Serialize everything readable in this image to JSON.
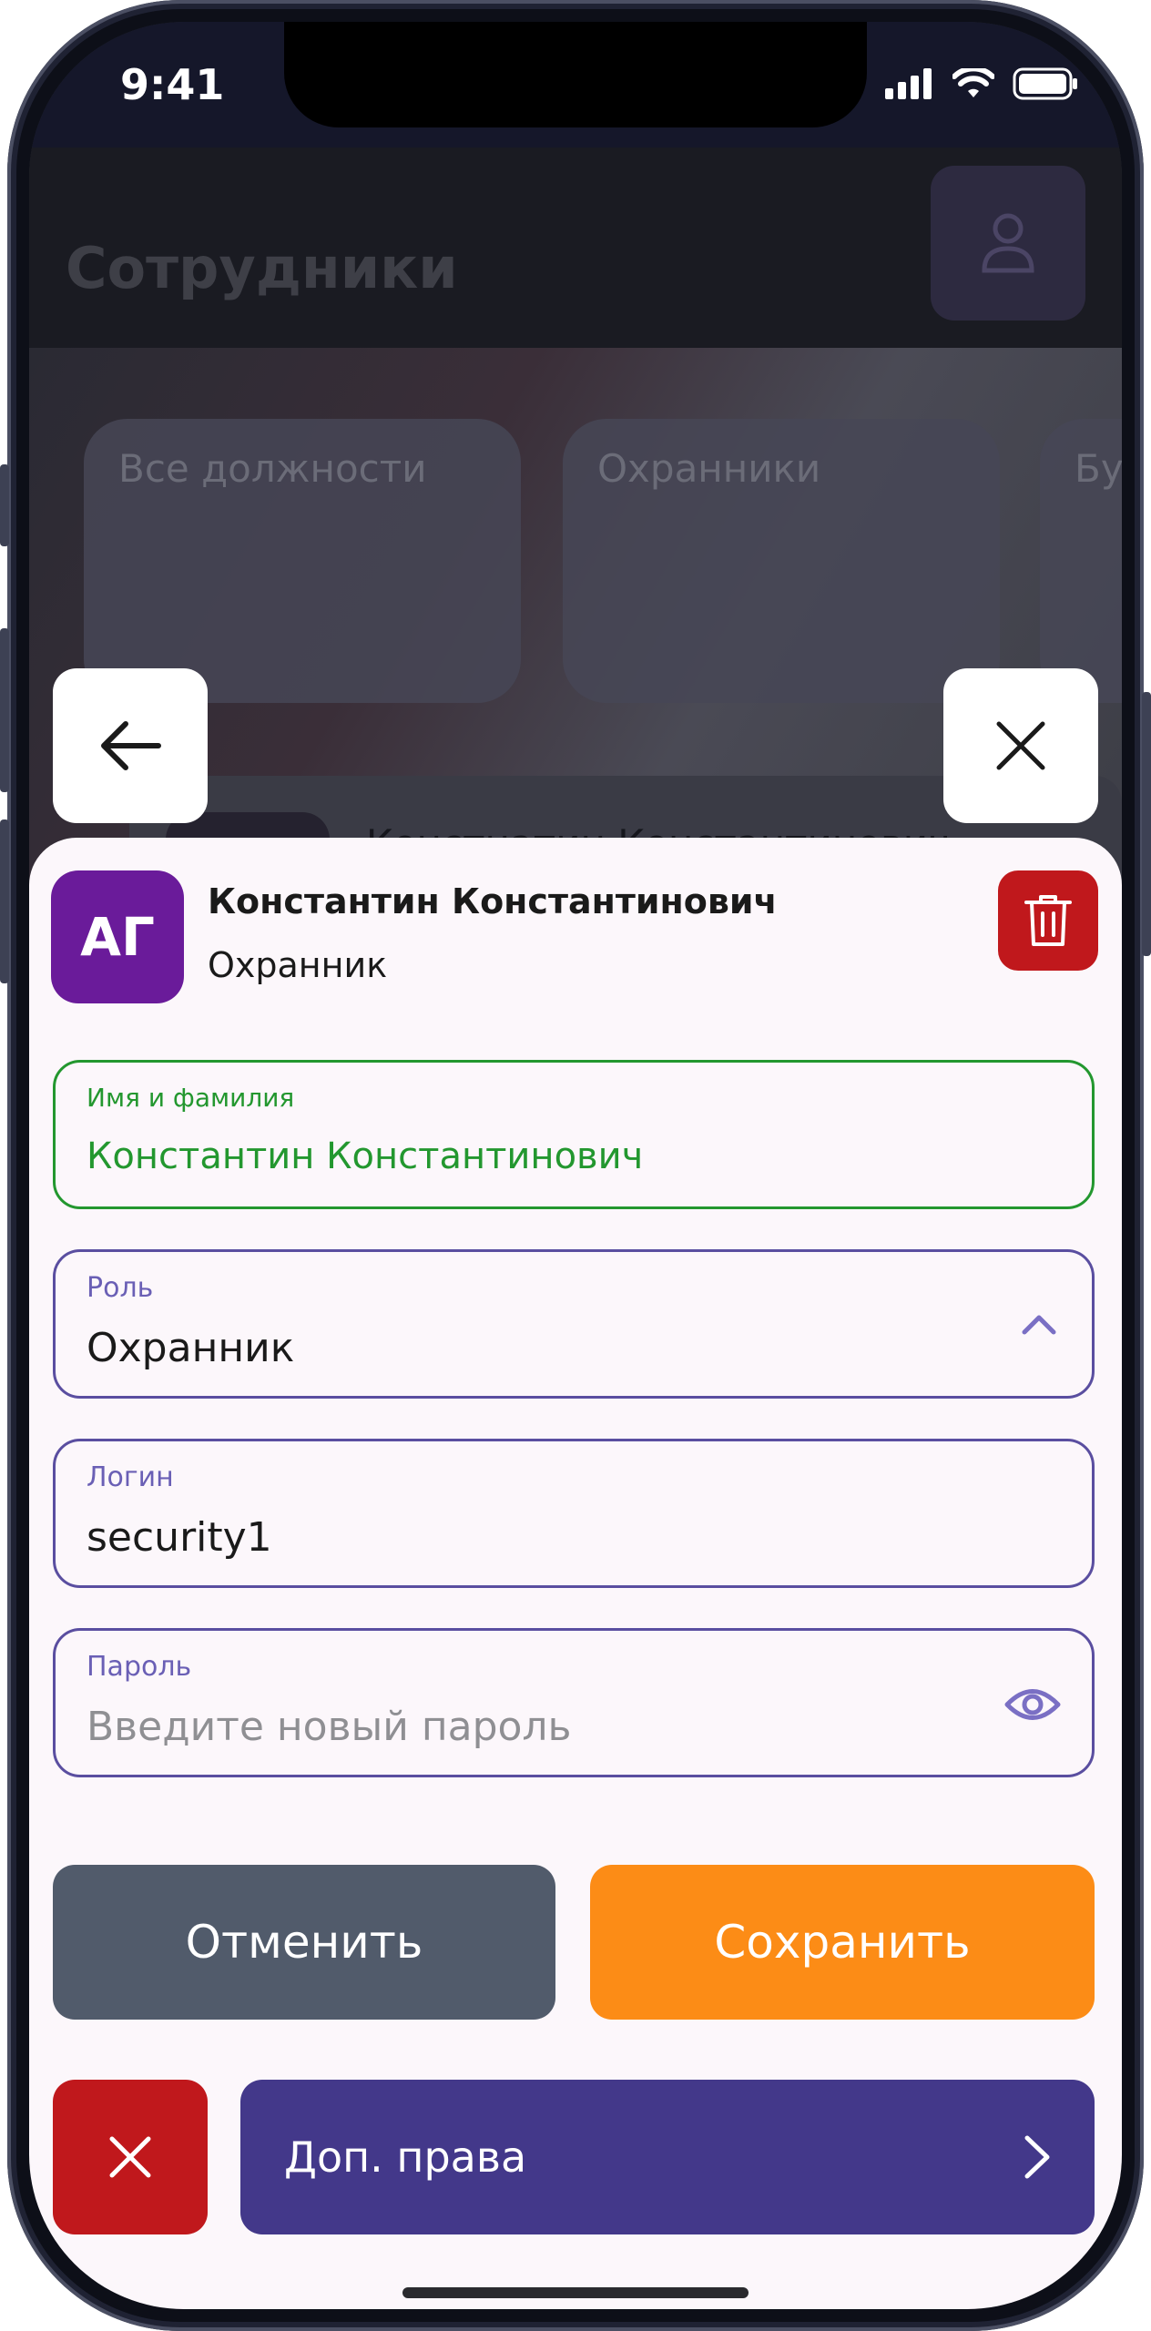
{
  "status_bar": {
    "time": "9:41"
  },
  "background": {
    "title": "Сотрудники",
    "categories": [
      "Все должности",
      "Охранники",
      "Бу"
    ],
    "employee_preview": "Констнатин Константинович"
  },
  "sheet": {
    "avatar_initials": "АГ",
    "employee_name": "Константин Константинович",
    "employee_role": "Охранник",
    "fields": {
      "name": {
        "label": "Имя и фамилия",
        "value": "Константин Константинович"
      },
      "role": {
        "label": "Роль",
        "value": "Охранник"
      },
      "login": {
        "label": "Логин",
        "value": "security1"
      },
      "password": {
        "label": "Пароль",
        "placeholder": "Введите новый пароль"
      }
    },
    "buttons": {
      "cancel": "Отменить",
      "save": "Сохранить",
      "rights": "Доп. права"
    }
  },
  "colors": {
    "accent_purple": "#43388a",
    "save_orange": "#fc8c16",
    "danger_red": "#c0181c",
    "active_green": "#23972f",
    "avatar_purple": "#6a1b9a"
  },
  "icons": [
    "back-arrow-icon",
    "close-icon",
    "trash-icon",
    "chevron-up-icon",
    "eye-icon",
    "chevron-right-icon",
    "user-icon",
    "signal-icon",
    "wifi-icon",
    "battery-icon"
  ]
}
